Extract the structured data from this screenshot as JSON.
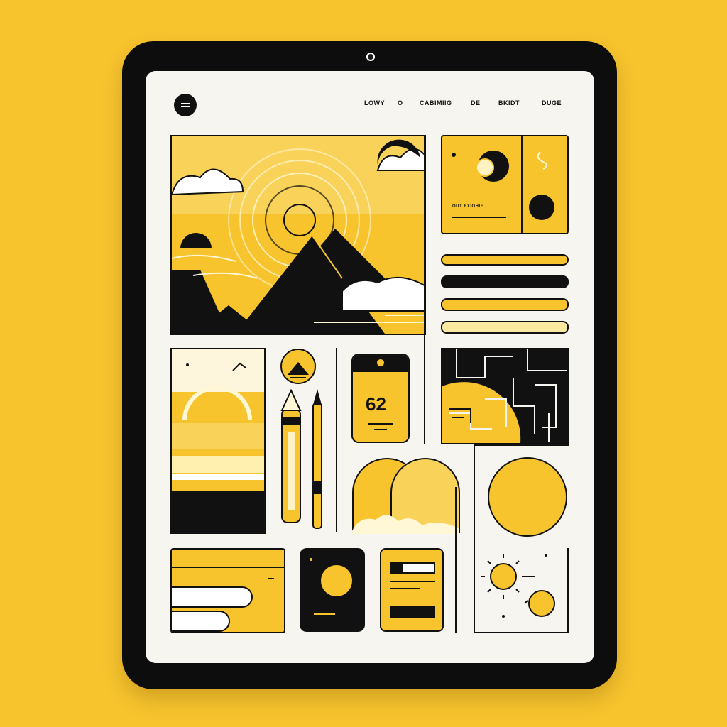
{
  "colors": {
    "accent": "#f7c42e",
    "ink": "#111111",
    "paper": "#f7f5ef",
    "pale": "#fbe9a2"
  },
  "header": {
    "menu_icon": "menu-icon",
    "nav": [
      "LOWY",
      "O",
      "CABIMIIG",
      "DE",
      "BKIDT",
      "DUGE"
    ]
  },
  "cards": {
    "info_card_caption": "OUT EXIOHIF",
    "calendar_value": "62"
  },
  "list_bars": [
    "bar-yellow",
    "bar-black",
    "bar-yellow",
    "bar-pale"
  ],
  "icons": [
    "sun-icon",
    "mountain-icon",
    "cloud-icon",
    "pencil-icon",
    "moon-icon",
    "arch-icon"
  ]
}
